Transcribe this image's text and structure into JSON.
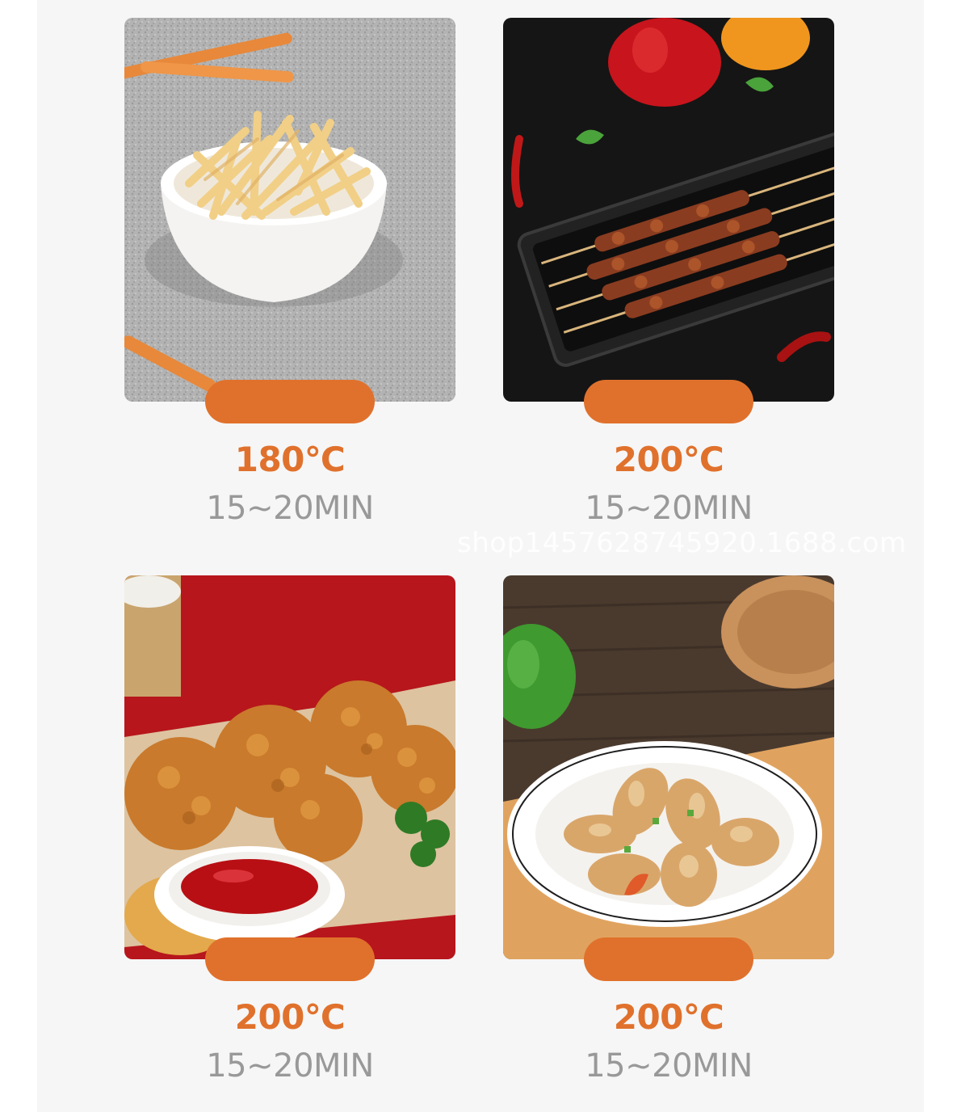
{
  "brand": {
    "accent": "#e0712c",
    "muted_text": "#999999",
    "panel_bg": "#f6f6f6"
  },
  "cards": [
    {
      "food": "fries-icon",
      "temperature": "180℃",
      "duration": "15~20MIN",
      "label": ""
    },
    {
      "food": "skewers-icon",
      "temperature": "200℃",
      "duration": "15~20MIN",
      "label": ""
    },
    {
      "food": "chicken-icon",
      "temperature": "200℃",
      "duration": "15~20MIN",
      "label": ""
    },
    {
      "food": "fish-icon",
      "temperature": "200℃",
      "duration": "15~20MIN",
      "label": ""
    }
  ],
  "watermark": "shop1457628745920.1688.com"
}
